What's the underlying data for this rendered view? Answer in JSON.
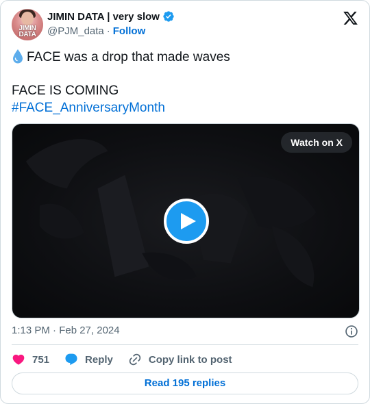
{
  "author": {
    "display_name": "JIMIN DATA | very slow",
    "handle": "@PJM_data",
    "separator": "·",
    "follow_label": "Follow",
    "avatar_text": "JIMIN\nDATA"
  },
  "tweet": {
    "line1": "FACE was a drop that made waves",
    "line2": "FACE IS COMING",
    "hashtag": "#FACE_AnniversaryMonth",
    "emoji_icon": "droplet-icon"
  },
  "media": {
    "watch_label": "Watch on X",
    "play_icon": "play-icon"
  },
  "timestamp": "1:13 PM · Feb 27, 2024",
  "actions": {
    "like_count": "751",
    "reply_label": "Reply",
    "copy_label": "Copy link to post"
  },
  "read_replies_label": "Read 195 replies",
  "colors": {
    "accent": "#1d9bf0",
    "link": "#006fd6",
    "like": "#f91880",
    "muted": "#536471",
    "border": "#cfd9de"
  }
}
